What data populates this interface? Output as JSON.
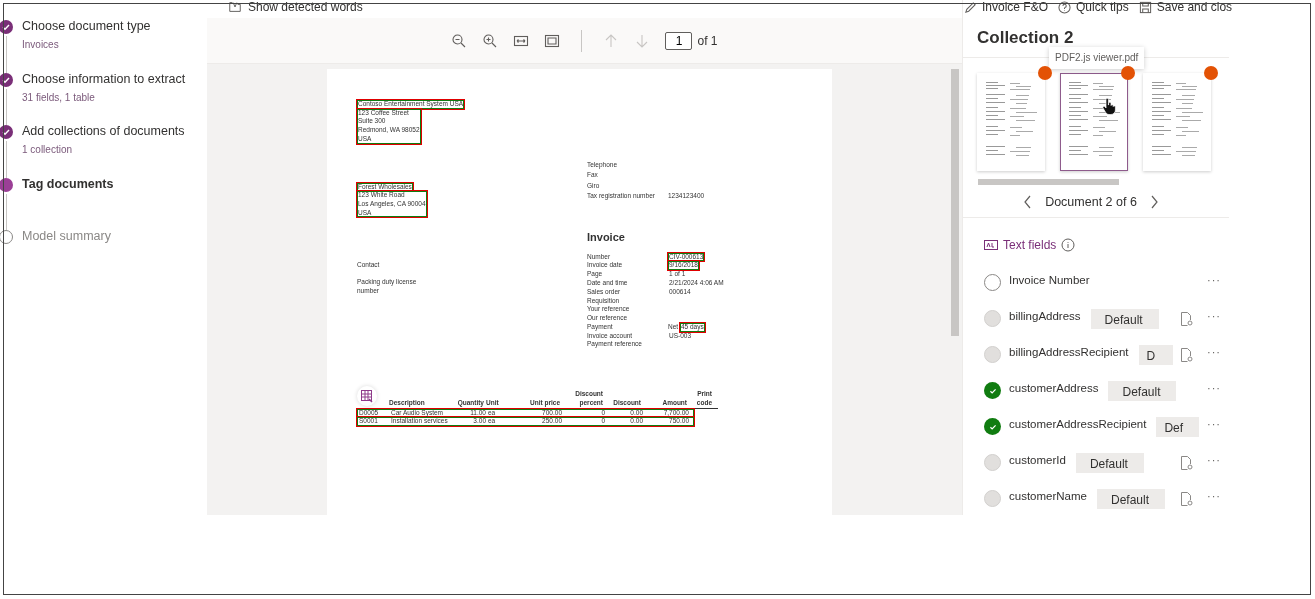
{
  "steps": [
    {
      "title": "Choose document type",
      "subtitle": "Invoices",
      "completed": true,
      "selected": false
    },
    {
      "title": "Choose information to extract",
      "subtitle": "31 fields, 1 table",
      "completed": true,
      "selected": false
    },
    {
      "title": "Add collections of documents",
      "subtitle": "1 collection",
      "completed": true,
      "selected": false
    },
    {
      "title": "Tag documents",
      "completed": false,
      "selected": true
    },
    {
      "title": "Model summary",
      "completed": false,
      "selected": false
    }
  ],
  "viewer": {
    "show_detected_words": "Show detected words",
    "page_input": "1",
    "page_total": "of 1",
    "document": {
      "sender": {
        "name": "Contoso Entertainment System USA",
        "address": [
          "123 Coffee Street",
          "Suite 300",
          "Redmond, WA 98052",
          "USA"
        ]
      },
      "customer": {
        "name": "Forest Wholesales",
        "address": [
          "123 White Road",
          "Los Angeles, CA 90004",
          "USA"
        ]
      },
      "contact_labels": [
        "Contact",
        "Packing duty license number"
      ],
      "company_info": [
        {
          "label": "Telephone"
        },
        {
          "label": "Fax"
        },
        {
          "label": "Giro"
        },
        {
          "label": "Tax registration number",
          "value": "1234123400"
        }
      ],
      "title": "Invoice",
      "details": [
        {
          "label": "Number",
          "value": "CIV-000613",
          "tagged": true
        },
        {
          "label": "Invoice date",
          "value": "9/16/2018",
          "tagged": true
        },
        {
          "label": "Page",
          "value": "1    of    1",
          "tagged": false
        },
        {
          "label": "Date and time",
          "value": "2/21/2024 4:06 AM",
          "tagged": false
        },
        {
          "label": "Sales order",
          "value": "000614",
          "tagged": false
        },
        {
          "label": "Requisition"
        },
        {
          "label": "Your reference"
        },
        {
          "label": "Our reference"
        },
        {
          "label": "Payment",
          "prefix": "Net",
          "value": "45 days",
          "tagged": true
        },
        {
          "label": "Invoice account",
          "value": "US-003",
          "tagged": false
        },
        {
          "label": "Payment reference"
        }
      ],
      "line_columns": [
        "",
        "Description",
        "Quantity",
        "Unit",
        "Unit price",
        "Discount percent",
        "Discount",
        "Amount",
        "Print code"
      ],
      "line_rows": [
        {
          "cells": [
            "D0005",
            "Car Audio System",
            "11.00",
            "ea",
            "700.00",
            "0",
            "0.00",
            "7,700.00"
          ],
          "tagged": true
        },
        {
          "cells": [
            "S0001",
            "Installation services",
            "3.00",
            "ea",
            "250.00",
            "0",
            "0.00",
            "750.00"
          ],
          "tagged": true
        }
      ]
    }
  },
  "panel": {
    "actions": [
      "Invoice F&O",
      "Quick tips",
      "Save and clos"
    ],
    "title": "Collection 2",
    "tooltip": "PDF2.js viewer.pdf",
    "thumbnails": [
      {
        "selected": false
      },
      {
        "selected": true
      },
      {
        "selected": false
      }
    ],
    "navigation": "Document 2 of 6",
    "section": "Text fields",
    "fields": [
      {
        "name": "Invoice Number",
        "checked": false,
        "disabled": false,
        "menu": "···"
      },
      {
        "name": "billingAddress",
        "checked": false,
        "disabled": true,
        "button": "Default",
        "doc_icon": true,
        "menu": "···"
      },
      {
        "name": "billingAddressRecipient",
        "checked": false,
        "disabled": true,
        "button": "D",
        "doc_icon": true,
        "menu": "···"
      },
      {
        "name": "customerAddress",
        "checked": true,
        "disabled": false,
        "button": "Default",
        "doc_icon": false,
        "menu": "···"
      },
      {
        "name": "customerAddressRecipient",
        "checked": true,
        "disabled": false,
        "button": "Def",
        "doc_icon": false,
        "menu": "···"
      },
      {
        "name": "customerId",
        "checked": false,
        "disabled": true,
        "button": "Default",
        "doc_icon": true,
        "menu": "···"
      },
      {
        "name": "customerName",
        "checked": false,
        "disabled": true,
        "button": "Default",
        "doc_icon": true,
        "menu": "···"
      }
    ]
  }
}
